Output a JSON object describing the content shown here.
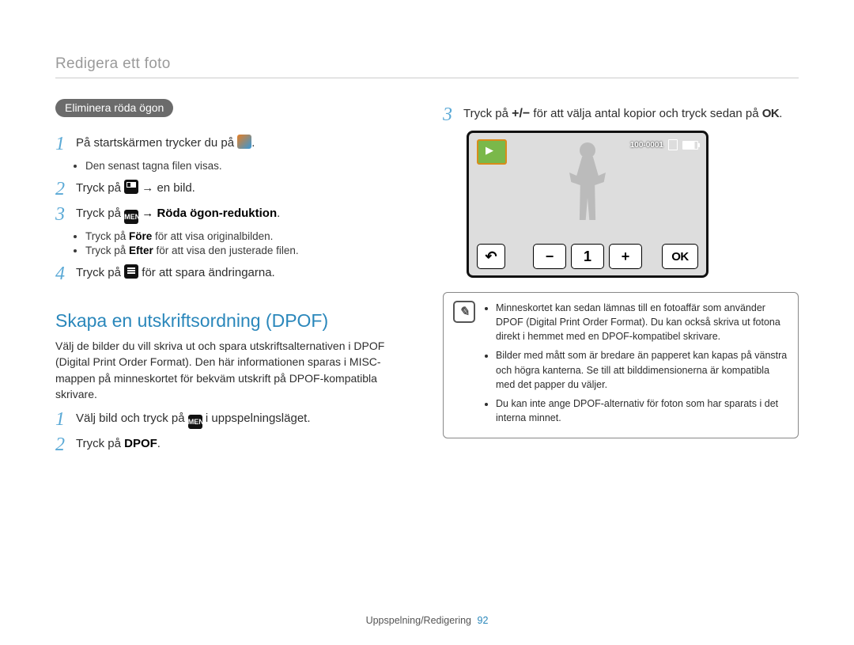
{
  "header": "Redigera ett foto",
  "left": {
    "pill": "Eliminera röda ögon",
    "steps": [
      {
        "num": "1",
        "pre": "På startskärmen trycker du på ",
        "icon": "img-icon",
        "post": "."
      },
      {
        "num": "2",
        "pre": "Tryck på ",
        "icon": "thumb-icon",
        "post": " → en bild."
      },
      {
        "num": "3",
        "pre": "Tryck på ",
        "icon": "menu-icon",
        "post_bold": " → Röda ögon-reduktion",
        "post": "."
      },
      {
        "num": "4",
        "pre": "Tryck på ",
        "icon": "save-icon",
        "post": " för att spara ändringarna."
      }
    ],
    "sub_a_1": "Den senast tagna filen visas.",
    "sub_c_1_pre": "Tryck på ",
    "sub_c_1_b": "Före",
    "sub_c_1_post": " för att visa originalbilden.",
    "sub_c_2_pre": "Tryck på ",
    "sub_c_2_b": "Efter",
    "sub_c_2_post": " för att visa den justerade filen.",
    "h2": "Skapa en utskriftsordning (DPOF)",
    "para": "Välj de bilder du vill skriva ut och spara utskriftsalternativen i DPOF (Digital Print Order Format). Den här informationen sparas i MISC-mappen på minneskortet för bekväm utskrift på DPOF-kompatibla skrivare.",
    "d_steps": [
      {
        "num": "1",
        "pre": "Välj bild och tryck på ",
        "icon": "menu-icon",
        "post": " i uppspelningsläget."
      },
      {
        "num": "2",
        "pre": "Tryck på ",
        "bold": "DPOF",
        "post": "."
      }
    ]
  },
  "right": {
    "step3_pre": "Tryck på ",
    "step3_pm": "+/−",
    "step3_mid": " för att välja antal kopior och tryck sedan på ",
    "step3_ok": "OK",
    "step3_post": ".",
    "screen": {
      "counter": "100-0001",
      "value": "1",
      "ok": "OK",
      "minus": "−",
      "plus": "+",
      "back": "↶"
    },
    "note": [
      "Minneskortet kan sedan lämnas till en fotoaffär som använder DPOF (Digital Print Order Format). Du kan också skriva ut fotona direkt i hemmet med en DPOF-kompatibel skrivare.",
      "Bilder med mått som är bredare än papperet kan kapas på vänstra och högra kanterna. Se till att bilddimensionerna är kompatibla med det papper du väljer.",
      "Du kan inte ange DPOF-alternativ för foton som har sparats i det interna minnet."
    ]
  },
  "footer": {
    "section": "Uppspelning/Redigering",
    "page": "92"
  },
  "menu_label": "MENU"
}
